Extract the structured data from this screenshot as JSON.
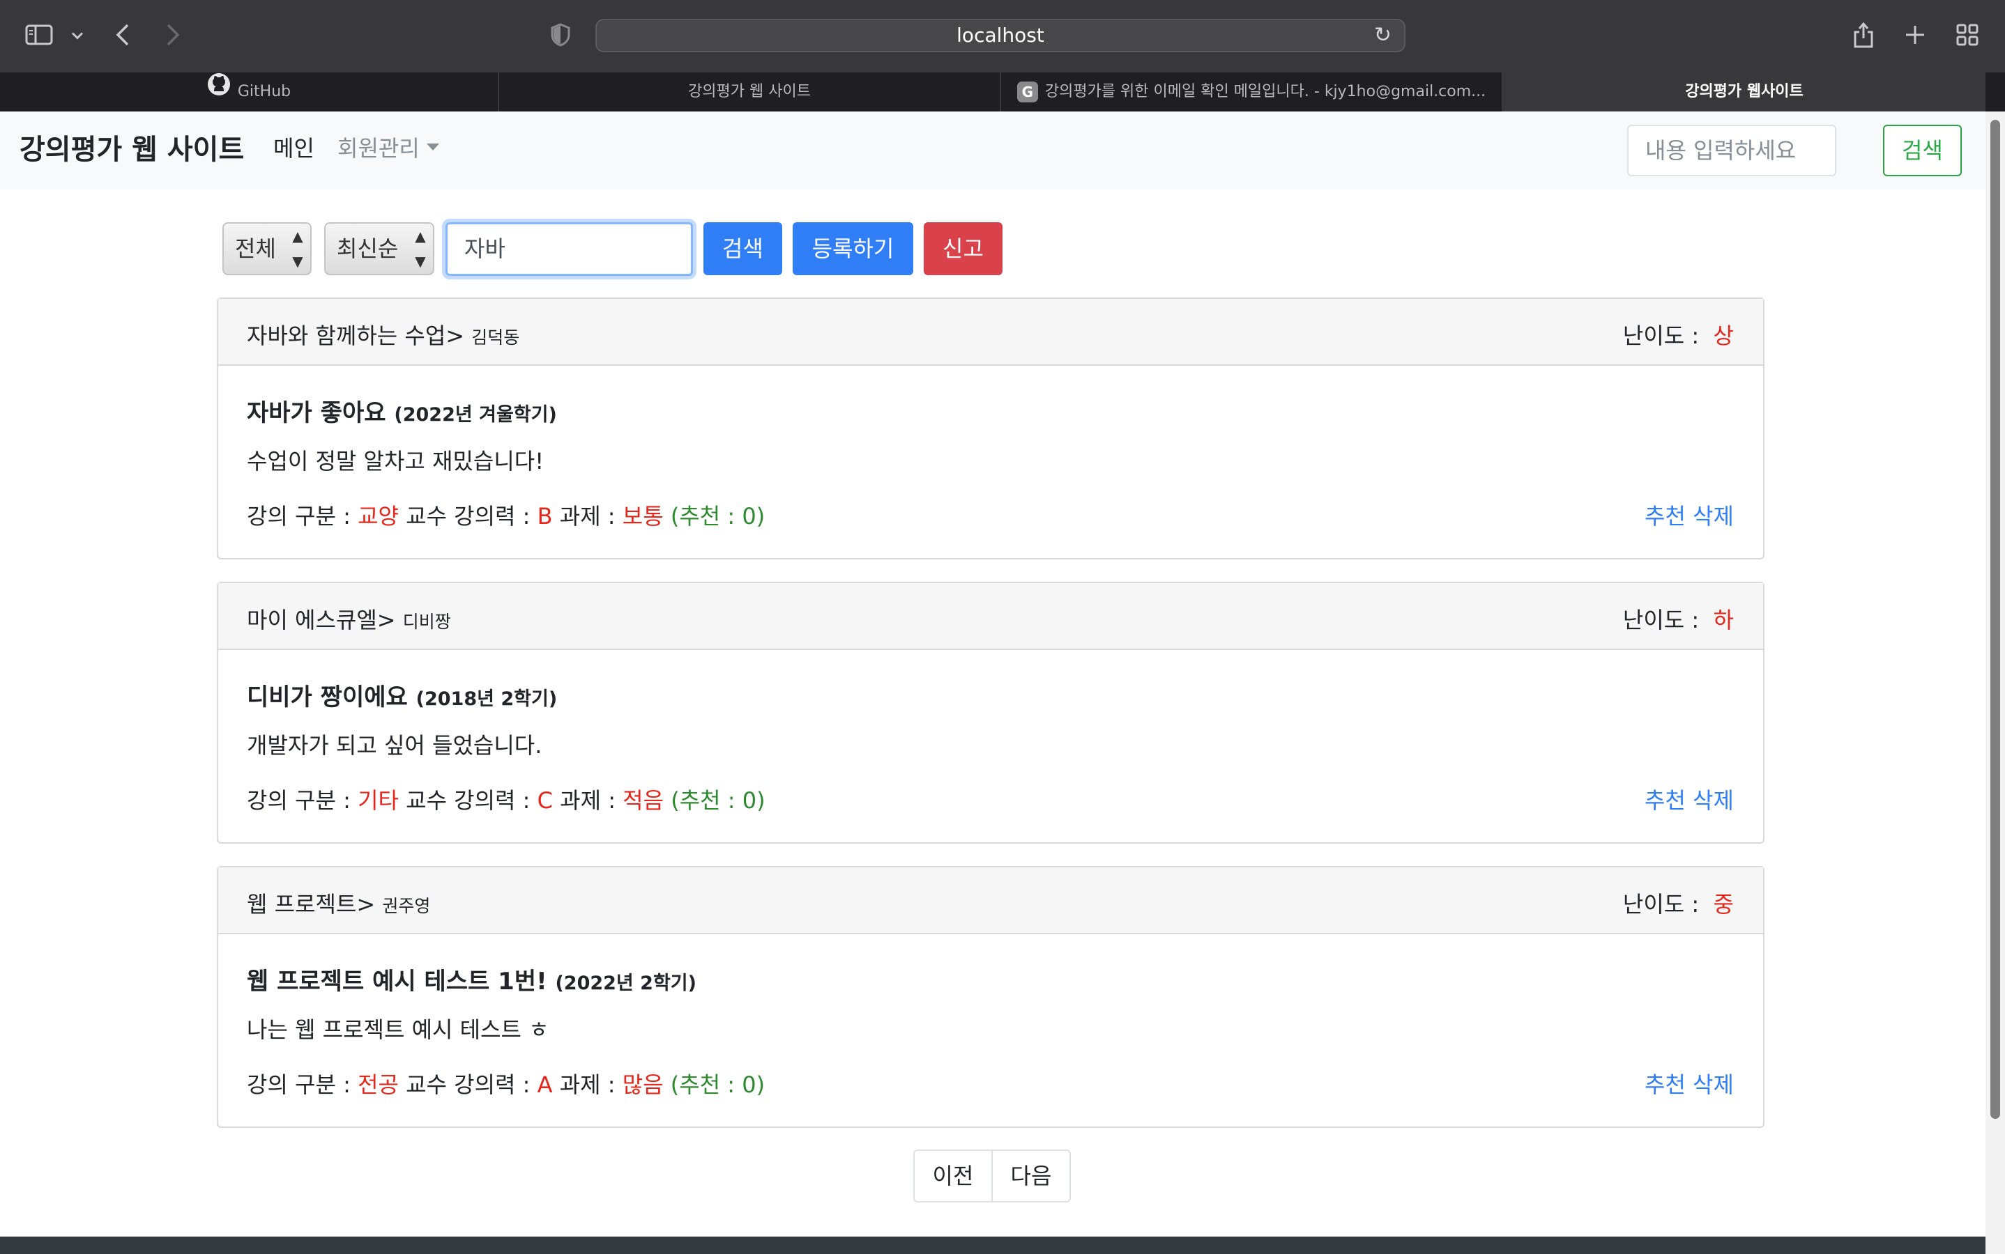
{
  "browser": {
    "url": "localhost",
    "tabs": [
      {
        "label": "GitHub",
        "favicon": "github-icon"
      },
      {
        "label": "강의평가 웹 사이트"
      },
      {
        "label": "강의평가를 위한 이메일 확인 메일입니다. - kjy1ho@gmail.com...",
        "favicon": "gmail-icon"
      },
      {
        "label": "강의평가 웹사이트",
        "active": true
      }
    ]
  },
  "navbar": {
    "brand": "강의평가 웹 사이트",
    "main_link": "메인",
    "member_menu": "회원관리",
    "search_placeholder": "내용 입력하세요",
    "search_button": "검색"
  },
  "filters": {
    "category": "전체",
    "sort": "최신순",
    "query": "자바",
    "search_button": "검색",
    "register_button": "등록하기",
    "report_button": "신고"
  },
  "labels": {
    "difficulty": "난이도 :",
    "division": "강의 구분 :",
    "lecture_power": "교수 강의력 :",
    "assignment": "과제 :",
    "recommend_open": "(추천 :",
    "recommend_close": ")",
    "recommend_action": "추천",
    "delete_action": "삭제"
  },
  "evaluations": [
    {
      "lecture": "자바와 함께하는 수업>",
      "professor": "김덕동",
      "difficulty": "상",
      "title": "자바가 좋아요",
      "term": "(2022년 겨울학기)",
      "content": "수업이 정말 알차고 재밌습니다!",
      "division": "교양",
      "grade": "B",
      "assignment": "보통",
      "recommend": "0"
    },
    {
      "lecture": "마이 에스큐엘>",
      "professor": "디비짱",
      "difficulty": "하",
      "title": "디비가 짱이에요",
      "term": "(2018년 2학기)",
      "content": "개발자가 되고 싶어 들었습니다.",
      "division": "기타",
      "grade": "C",
      "assignment": "적음",
      "recommend": "0"
    },
    {
      "lecture": "웹 프로젝트>",
      "professor": "권주영",
      "difficulty": "중",
      "title": "웹 프로젝트 예시 테스트 1번!",
      "term": "(2022년 2학기)",
      "content": "나는 웹 프로젝트 예시 테스트 ㅎ",
      "division": "전공",
      "grade": "A",
      "assignment": "많음",
      "recommend": "0"
    }
  ],
  "pagination": {
    "prev": "이전",
    "next": "다음"
  },
  "colors": {
    "primary": "#2f7ef5",
    "danger": "#d9414b",
    "success": "#28a745",
    "value_red": "#e5261b",
    "value_green": "#2e8a2e"
  }
}
